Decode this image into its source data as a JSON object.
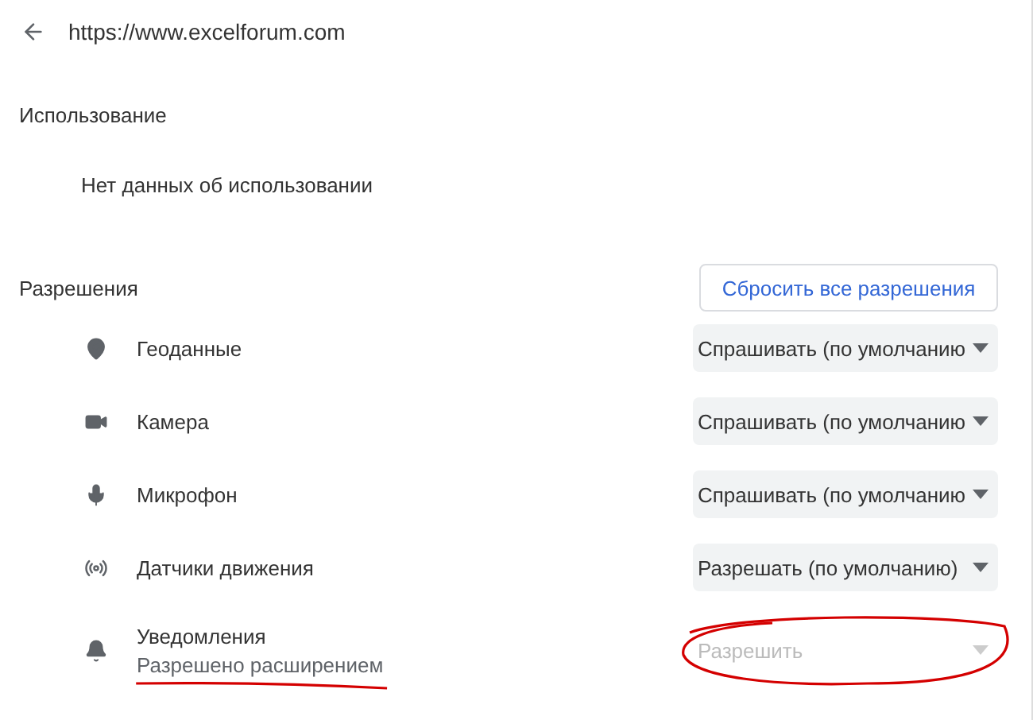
{
  "header": {
    "url": "https://www.excelforum.com"
  },
  "usage": {
    "title": "Использование",
    "text": "Нет данных об использовании"
  },
  "permissions": {
    "title": "Разрешения",
    "reset_button": "Сбросить все разрешения",
    "items": [
      {
        "label": "Геоданные",
        "value": "Спрашивать (по умолчанию",
        "disabled": false
      },
      {
        "label": "Камера",
        "value": "Спрашивать (по умолчанию",
        "disabled": false
      },
      {
        "label": "Микрофон",
        "value": "Спрашивать (по умолчанию",
        "disabled": false
      },
      {
        "label": "Датчики движения",
        "value": "Разрешать (по умолчанию)",
        "disabled": false
      },
      {
        "label": "Уведомления",
        "note": "Разрешено расширением",
        "value": "Разрешить",
        "disabled": true,
        "circled": true,
        "note_underlined": true
      }
    ]
  }
}
